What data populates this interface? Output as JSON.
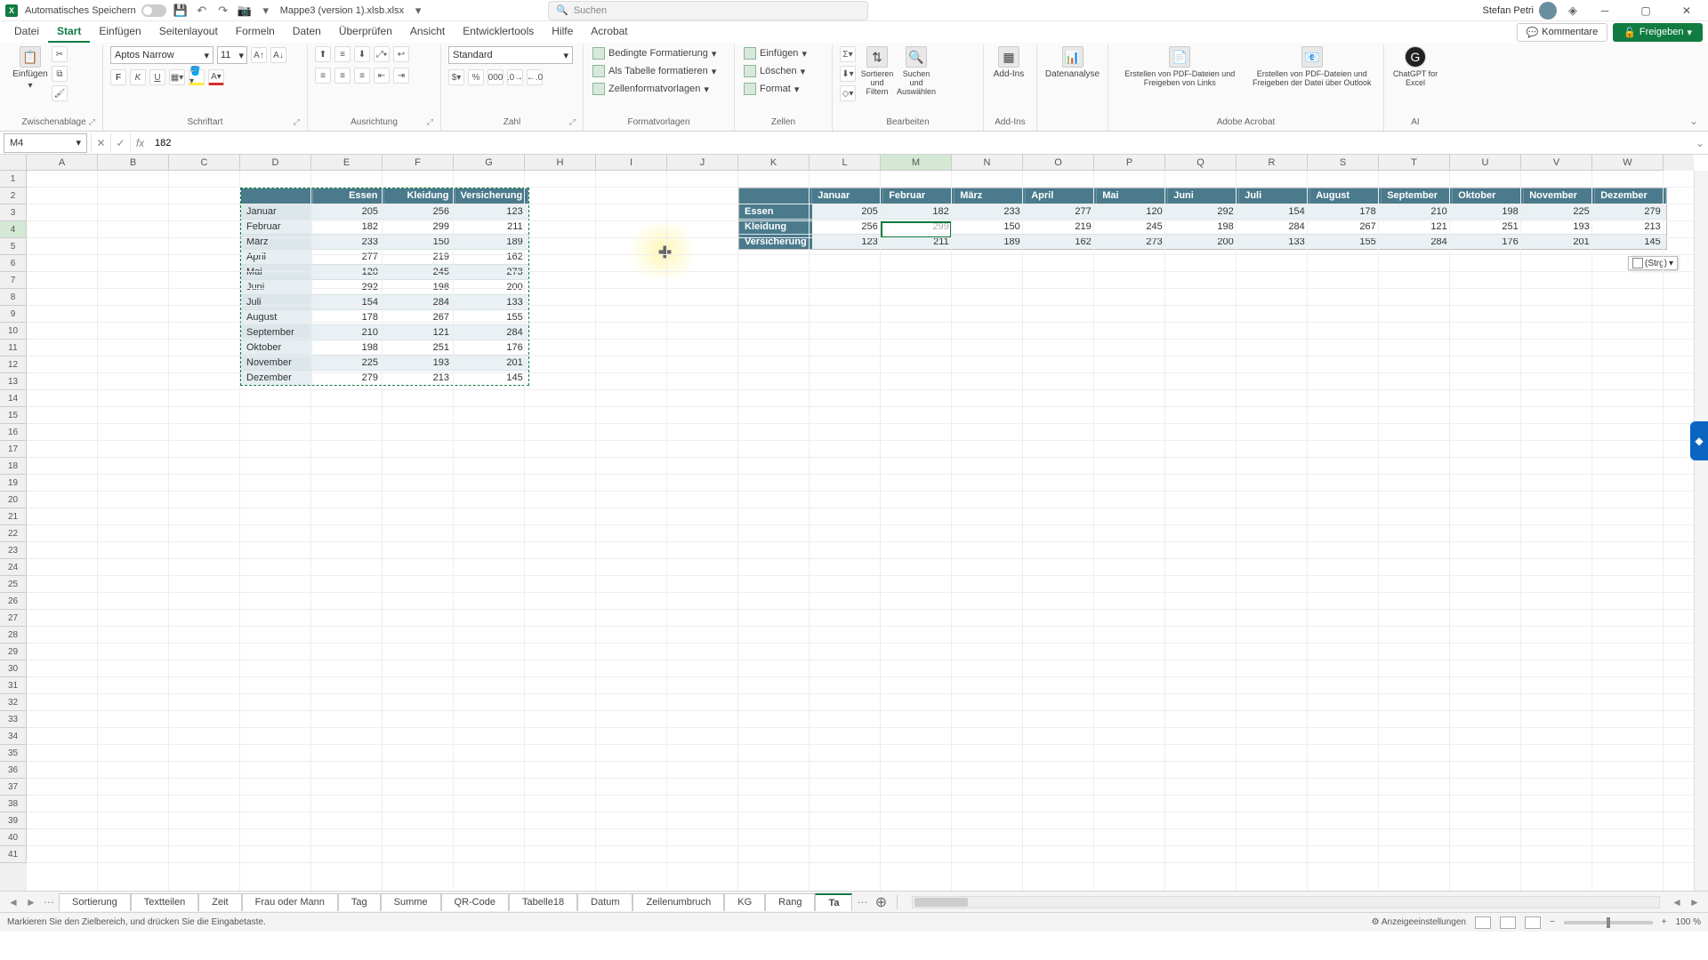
{
  "titlebar": {
    "autosave": "Automatisches Speichern",
    "doc": "Mappe3 (version 1).xlsb.xlsx",
    "search_placeholder": "Suchen",
    "user": "Stefan Petri"
  },
  "tabs": [
    "Datei",
    "Start",
    "Einfügen",
    "Seitenlayout",
    "Formeln",
    "Daten",
    "Überprüfen",
    "Ansicht",
    "Entwicklertools",
    "Hilfe",
    "Acrobat"
  ],
  "tabs_active": 1,
  "comments": "Kommentare",
  "share": "Freigeben",
  "ribbon": {
    "paste": "Einfügen",
    "clipboard": "Zwischenablage",
    "font_name": "Aptos Narrow",
    "font_size": "11",
    "font": "Schriftart",
    "alignment": "Ausrichtung",
    "number_format": "Standard",
    "number": "Zahl",
    "cond_format": "Bedingte Formatierung",
    "as_table": "Als Tabelle formatieren",
    "cell_styles": "Zellenformatvorlagen",
    "styles": "Formatvorlagen",
    "insert": "Einfügen",
    "delete": "Löschen",
    "format": "Format",
    "cells": "Zellen",
    "sort_filter": "Sortieren und Filtern",
    "find_select": "Suchen und Auswählen",
    "editing": "Bearbeiten",
    "addins": "Add-Ins",
    "addins_grp": "Add-Ins",
    "data_analysis": "Datenanalyse",
    "pdf1": "Erstellen von PDF-Dateien und Freigeben von Links",
    "pdf2": "Erstellen von PDF-Dateien und Freigeben der Datei über Outlook",
    "acrobat": "Adobe Acrobat",
    "chatgpt": "ChatGPT for Excel",
    "ai": "AI"
  },
  "namebox": "M4",
  "formula": "182",
  "cols": [
    "A",
    "B",
    "C",
    "D",
    "E",
    "F",
    "G",
    "H",
    "I",
    "J",
    "K",
    "L",
    "M",
    "N",
    "O",
    "P",
    "Q",
    "R",
    "S",
    "T",
    "U",
    "V",
    "W"
  ],
  "active_col_idx": 12,
  "active_row_idx": 3,
  "table1": {
    "headers": [
      "",
      "Essen",
      "Kleidung",
      "Versicherung"
    ],
    "rows": [
      [
        "Januar",
        205,
        256,
        123
      ],
      [
        "Februar",
        182,
        299,
        211
      ],
      [
        "März",
        233,
        150,
        189
      ],
      [
        "April",
        277,
        219,
        162
      ],
      [
        "Mai",
        120,
        245,
        273
      ],
      [
        "Juni",
        292,
        198,
        200
      ],
      [
        "Juli",
        154,
        284,
        133
      ],
      [
        "August",
        178,
        267,
        155
      ],
      [
        "September",
        210,
        121,
        284
      ],
      [
        "Oktober",
        198,
        251,
        176
      ],
      [
        "November",
        225,
        193,
        201
      ],
      [
        "Dezember",
        279,
        213,
        145
      ]
    ]
  },
  "table2": {
    "headers": [
      "",
      "Januar",
      "Februar",
      "März",
      "April",
      "Mai",
      "Juni",
      "Juli",
      "August",
      "September",
      "Oktober",
      "November",
      "Dezember"
    ],
    "rows": [
      [
        "Essen",
        205,
        182,
        233,
        277,
        120,
        292,
        154,
        178,
        210,
        198,
        225,
        279
      ],
      [
        "Kleidung",
        256,
        299,
        150,
        219,
        245,
        198,
        284,
        267,
        121,
        251,
        193,
        213
      ],
      [
        "Versicherung",
        123,
        211,
        189,
        162,
        273,
        200,
        133,
        155,
        284,
        176,
        201,
        145
      ]
    ]
  },
  "paste_tag": "(Strg)",
  "sheets": [
    "Sortierung",
    "Textteilen",
    "Zeit",
    "Frau oder Mann",
    "Tag",
    "Summe",
    "QR-Code",
    "Tabelle18",
    "Datum",
    "Zeilenumbruch",
    "KG",
    "Rang",
    "Ta"
  ],
  "status_text": "Markieren Sie den Zielbereich, und drücken Sie die Eingabetaste.",
  "display_settings": "Anzeigeeinstellungen",
  "zoom": "100 %"
}
